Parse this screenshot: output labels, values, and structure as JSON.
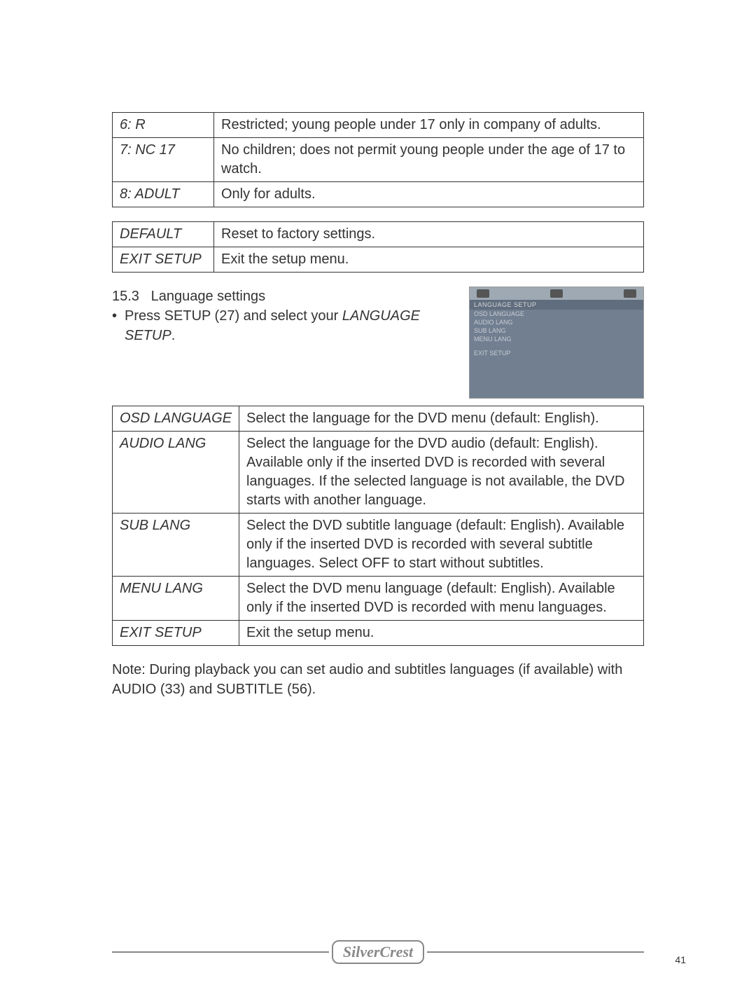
{
  "ratings": [
    {
      "key": "6: R",
      "desc": "Restricted; young people under 17 only in company of adults."
    },
    {
      "key": "7: NC 17",
      "desc": "No children; does not permit young people under the age of 17 to watch."
    },
    {
      "key": "8: ADULT",
      "desc": "Only for adults."
    }
  ],
  "misc": [
    {
      "key": "DEFAULT",
      "desc": "Reset to factory settings."
    },
    {
      "key": "EXIT SETUP",
      "desc": "Exit the setup menu."
    }
  ],
  "section": {
    "num": "15.3",
    "title": "Language settings",
    "line1a": "Press SETUP (27) and select your ",
    "line1b": "LANGUAGE SETUP",
    "line1c": "."
  },
  "mock": {
    "header": "LANGUAGE SETUP",
    "items": [
      "OSD LANGUAGE",
      "AUDIO LANG",
      "SUB LANG",
      "MENU LANG",
      "",
      "EXIT SETUP"
    ]
  },
  "lang_table": [
    {
      "key": "OSD LANGUAGE",
      "desc": "Select the language for the DVD menu (default: English)."
    },
    {
      "key": "AUDIO LANG",
      "desc": "Select the language for the DVD audio (default: English). Available only if the inserted DVD is recorded with several languages. If the selected language is not available, the DVD starts with another language."
    },
    {
      "key": "SUB LANG",
      "desc": "Select the DVD subtitle language (default: English). Available only if the inserted DVD is recorded with several subtitle languages. Select OFF to start without subtitles."
    },
    {
      "key": "MENU LANG",
      "desc": "Select the DVD menu language (default: English). Available only if the inserted DVD is recorded with menu languages."
    },
    {
      "key": "EXIT SETUP",
      "desc": "Exit the setup menu."
    }
  ],
  "note": "Note: During playback you can set audio and subtitles languages (if available) with AUDIO (33) and SUBTITLE (56).",
  "footer": {
    "brand": "SilverCrest",
    "page": "41"
  }
}
